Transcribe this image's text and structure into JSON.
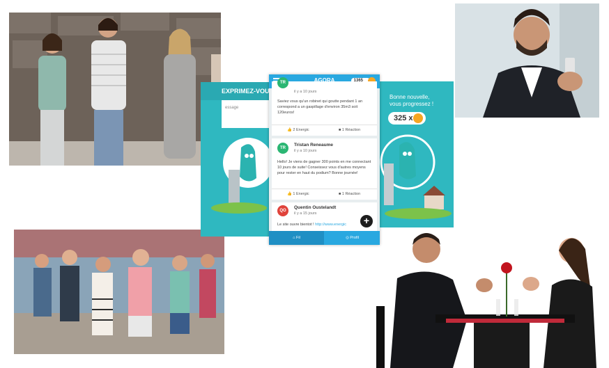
{
  "app": {
    "title": "AGORA",
    "points": "1365",
    "menu_icon": "hamburger-menu-icon",
    "coin_icon": "coin-icon"
  },
  "left_screen": {
    "header": "EXPRIMEZ-VOUS !",
    "placeholder": "essage"
  },
  "right_screen": {
    "line1": "Bonne nouvelle,",
    "line2": "vous progressez !",
    "count": "325 x"
  },
  "feed": [
    {
      "initials": "TR",
      "time": "il y a 10 jours",
      "body": "Saviez vous qu'un robinet qui goutte pendant 1 an correspond a un gaspillage d'environ 35m3 soit 120euros!",
      "energic": "2 Energic",
      "reaction": "1 Réaction"
    },
    {
      "initials": "TR",
      "author": "Tristan Reneaume",
      "time": "il y a 10 jours",
      "body": "Hello! Je viens de gagner 300 points en me connectant 10 jours de suite! Conseissez vous d'autres moyens pour rester en haut du podium? Bonne journée!",
      "energic": "1 Energic",
      "reaction": "1 Réaction"
    },
    {
      "initials": "QO",
      "author": "Quentin Oustelandt",
      "time": "il y a 15 jours",
      "body": "Le site ouvre bientot !",
      "link": "http://www.energic"
    }
  ],
  "fab_label": "+",
  "bottom_tabs": [
    {
      "label": "Fil",
      "icon": "home-icon"
    },
    {
      "label": "Profil",
      "icon": "globe-icon"
    }
  ],
  "colors": {
    "accent": "#29a8e0",
    "teal": "#2fb8c0",
    "avatar_tr": "#2bb673",
    "avatar_qo": "#e0433b",
    "coin": "#f5a623"
  }
}
